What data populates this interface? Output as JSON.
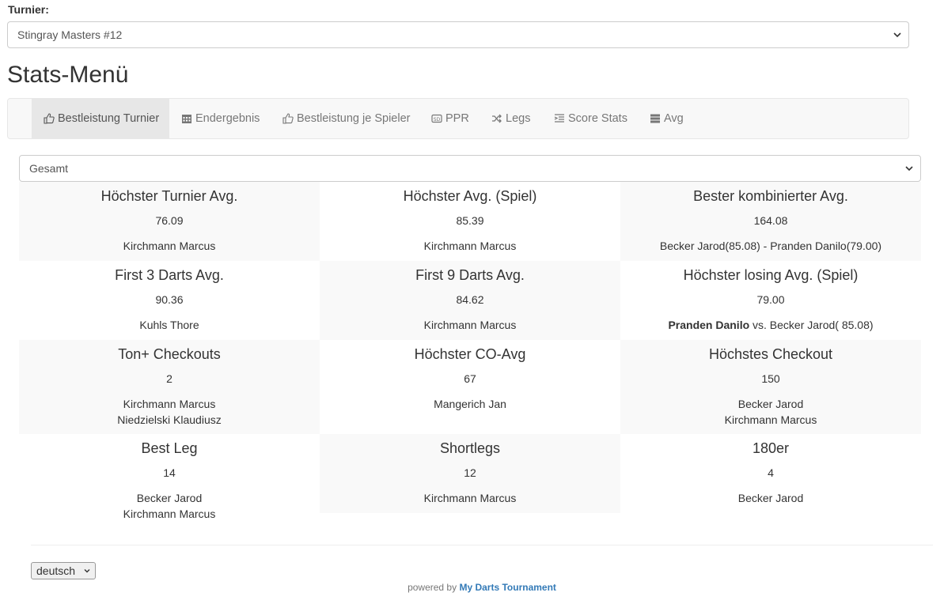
{
  "turnier": {
    "label": "Turnier:",
    "selected": "Stingray Masters #12"
  },
  "page_title": "Stats-Menü",
  "nav": {
    "items": [
      {
        "label": "Bestleistung Turnier",
        "icon": "thumbs-up-icon",
        "active": true
      },
      {
        "label": "Endergebnis",
        "icon": "calendar-icon",
        "active": false
      },
      {
        "label": "Bestleistung je Spieler",
        "icon": "thumbs-up-icon",
        "active": false
      },
      {
        "label": "PPR",
        "icon": "sd-video-icon",
        "active": false
      },
      {
        "label": "Legs",
        "icon": "random-icon",
        "active": false
      },
      {
        "label": "Score Stats",
        "icon": "indent-icon",
        "active": false
      },
      {
        "label": "Avg",
        "icon": "tasks-icon",
        "active": false
      }
    ]
  },
  "filter": {
    "selected": "Gesamt"
  },
  "stats": [
    {
      "title": "Höchster Turnier Avg.",
      "value": "76.09",
      "names": [
        "Kirchmann Marcus"
      ]
    },
    {
      "title": "Höchster Avg. (Spiel)",
      "value": "85.39",
      "names": [
        "Kirchmann Marcus"
      ]
    },
    {
      "title": "Bester kombinierter Avg.",
      "value": "164.08",
      "names": [
        "Becker Jarod(85.08) - Pranden Danilo(79.00)"
      ]
    },
    {
      "title": "First 3 Darts Avg.",
      "value": "90.36",
      "names": [
        "Kuhls Thore"
      ]
    },
    {
      "title": "First 9 Darts Avg.",
      "value": "84.62",
      "names": [
        "Kirchmann Marcus"
      ]
    },
    {
      "title": "Höchster losing Avg. (Spiel)",
      "value": "79.00",
      "winner": "Pranden Danilo",
      "rest": " vs. Becker Jarod( 85.08)"
    },
    {
      "title": "Ton+ Checkouts",
      "value": "2",
      "names": [
        "Kirchmann Marcus",
        "Niedzielski Klaudiusz"
      ]
    },
    {
      "title": "Höchster CO-Avg",
      "value": "67",
      "names": [
        "Mangerich Jan"
      ]
    },
    {
      "title": "Höchstes Checkout",
      "value": "150",
      "names": [
        "Becker Jarod",
        "Kirchmann Marcus"
      ]
    },
    {
      "title": "Best Leg",
      "value": "14",
      "names": [
        "Becker Jarod",
        "Kirchmann Marcus"
      ]
    },
    {
      "title": "Shortlegs",
      "value": "12",
      "names": [
        "Kirchmann Marcus"
      ]
    },
    {
      "title": "180er",
      "value": "4",
      "names": [
        "Becker Jarod"
      ]
    }
  ],
  "footer": {
    "language": "deutsch",
    "powered_prefix": "powered by",
    "powered_link": "My Darts Tournament",
    "link_color": "#337ab7"
  }
}
